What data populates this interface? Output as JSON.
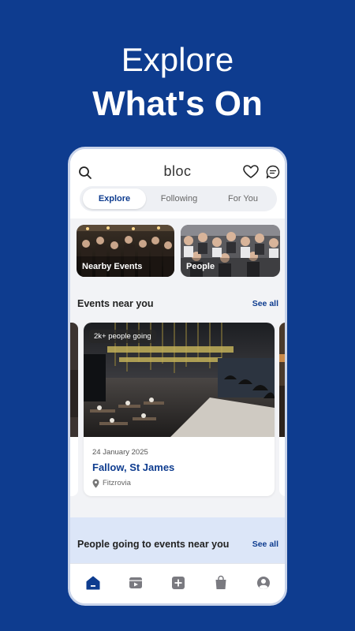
{
  "promo": {
    "line1": "Explore",
    "line2": "What's On"
  },
  "app": {
    "logo": "bloc",
    "header_icons": [
      "search-icon",
      "heart-icon",
      "chat-icon"
    ],
    "tabs": [
      {
        "label": "Explore",
        "active": true
      },
      {
        "label": "Following",
        "active": false
      },
      {
        "label": "For You",
        "active": false
      }
    ],
    "categories": [
      {
        "label": "Nearby Events",
        "image": "crowd-party-photo"
      },
      {
        "label": "People",
        "image": "crowd-party-photo"
      }
    ],
    "events_section": {
      "title": "Events near you",
      "see_all": "See all"
    },
    "event_card": {
      "badge": "2k+ people going",
      "date": "24 January 2025",
      "venue": "Fallow, St James",
      "location": "Fitzrovia",
      "image": "restaurant-interior-photo"
    },
    "people_section": {
      "title": "People going to events near you",
      "see_all": "See all"
    },
    "bottom_nav": [
      {
        "name": "home",
        "icon": "home-icon",
        "active": true
      },
      {
        "name": "videos",
        "icon": "video-icon",
        "active": false
      },
      {
        "name": "create",
        "icon": "plus-icon",
        "active": false
      },
      {
        "name": "shop",
        "icon": "bag-icon",
        "active": false
      },
      {
        "name": "profile",
        "icon": "profile-icon",
        "active": false
      }
    ],
    "colors": {
      "brand": "#0e3c8f",
      "background": "#f2f3f6",
      "accent_light": "#dce6f8"
    }
  }
}
